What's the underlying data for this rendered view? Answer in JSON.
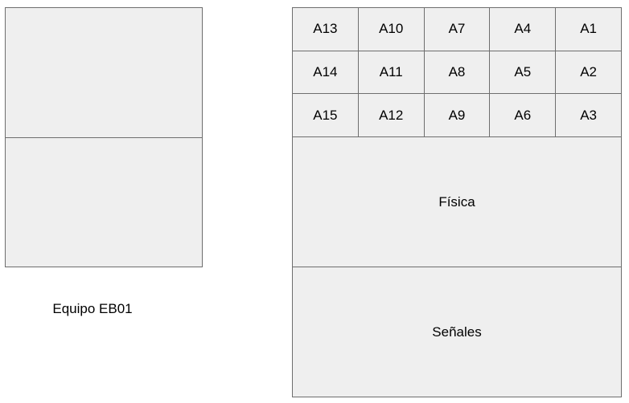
{
  "equipo": {
    "label": "Equipo EB01"
  },
  "grid": {
    "rows": [
      [
        "A13",
        "A10",
        "A7",
        "A4",
        "A1"
      ],
      [
        "A14",
        "A11",
        "A8",
        "A5",
        "A2"
      ],
      [
        "A15",
        "A12",
        "A9",
        "A6",
        "A3"
      ]
    ]
  },
  "panels": {
    "fisica": "Física",
    "senales": "Señales"
  },
  "colors": {
    "fill": "#efefef",
    "stroke": "#6e6e6e"
  }
}
